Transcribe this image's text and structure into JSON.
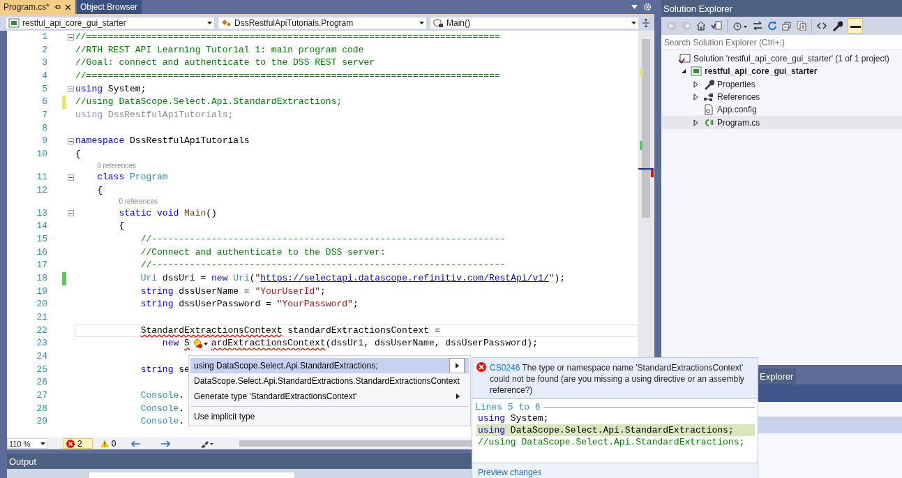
{
  "editor": {
    "tabs": [
      {
        "label": "Program.cs*",
        "selected": true
      },
      {
        "label": "Object Browser",
        "selected": false
      }
    ],
    "navigation": [
      {
        "kind": "project",
        "label": "restful_api_core_gui_starter"
      },
      {
        "kind": "class",
        "label": "DssRestfulApiTutorials.Program"
      },
      {
        "kind": "method",
        "label": "Main()"
      }
    ],
    "lines": [
      {
        "kind": "code",
        "number": "1",
        "fold": true,
        "current": false,
        "segs": [
          {
            "kind": "comment",
            "t": "//============================================================================"
          }
        ]
      },
      {
        "kind": "code",
        "number": "2",
        "fold": false,
        "current": false,
        "segs": [
          {
            "kind": "comment",
            "t": "//RTH REST API Learning Tutorial 1: main program code"
          }
        ]
      },
      {
        "kind": "code",
        "number": "3",
        "fold": false,
        "current": false,
        "segs": [
          {
            "kind": "comment",
            "t": "//Goal: connect and authenticate to the DSS REST server"
          }
        ]
      },
      {
        "kind": "code",
        "number": "4",
        "fold": false,
        "current": false,
        "segs": [
          {
            "kind": "comment",
            "t": "//============================================================================"
          }
        ]
      },
      {
        "kind": "code",
        "number": "5",
        "fold": true,
        "current": false,
        "segs": [
          {
            "kind": "keyword",
            "t": "using"
          },
          {
            "kind": "plain",
            "t": " System;"
          }
        ]
      },
      {
        "kind": "code",
        "number": "6",
        "fold": false,
        "current": false,
        "color": "#efe56b",
        "segs": [
          {
            "kind": "comment",
            "t": "//using DataScope.Select.Api.StandardExtractions;"
          }
        ]
      },
      {
        "kind": "code",
        "number": "7",
        "fold": false,
        "current": false,
        "segs": [
          {
            "kind": "dim_keyword",
            "t": "using"
          },
          {
            "kind": "dim",
            "t": " DssRestfulApiTutorials;"
          }
        ]
      },
      {
        "kind": "code",
        "number": "8",
        "fold": false,
        "current": false
      },
      {
        "kind": "code",
        "number": "9",
        "fold": true,
        "current": false,
        "segs": [
          {
            "kind": "keyword",
            "t": "namespace"
          },
          {
            "kind": "plain",
            "t": " DssRestfulApiTutorials"
          }
        ]
      },
      {
        "kind": "code",
        "number": "10",
        "fold": false,
        "current": false,
        "segs": [
          {
            "kind": "plain",
            "t": "{"
          }
        ]
      },
      {
        "kind": "codelens",
        "text": "0 references"
      },
      {
        "kind": "code",
        "number": "11",
        "fold": true,
        "current": false,
        "segs": [
          {
            "kind": "keyword",
            "t": "    class"
          },
          {
            "kind": "type",
            "t": " Program"
          }
        ]
      },
      {
        "kind": "code",
        "number": "12",
        "fold": false,
        "current": false,
        "segs": [
          {
            "kind": "plain",
            "t": "    {"
          }
        ]
      },
      {
        "kind": "codelens",
        "text": "0 references"
      },
      {
        "kind": "code",
        "number": "13",
        "fold": true,
        "current": false,
        "segs": [
          {
            "kind": "keyword",
            "t": "        static void"
          },
          {
            "kind": "method",
            "t": " Main"
          },
          {
            "kind": "plain",
            "t": "()"
          }
        ]
      },
      {
        "kind": "code",
        "number": "14",
        "fold": false,
        "current": false,
        "segs": [
          {
            "kind": "plain",
            "t": "        {"
          }
        ]
      },
      {
        "kind": "code",
        "number": "15",
        "fold": false,
        "current": false,
        "segs": [
          {
            "kind": "comment",
            "t": "            //-----------------------------------------------------------------"
          }
        ]
      },
      {
        "kind": "code",
        "number": "16",
        "fold": false,
        "current": false,
        "segs": [
          {
            "kind": "comment",
            "t": "            //Connect and authenticate to the DSS server:"
          }
        ]
      },
      {
        "kind": "code",
        "number": "17",
        "fold": false,
        "current": false,
        "segs": [
          {
            "kind": "comment",
            "t": "            //-----------------------------------------------------------------"
          }
        ]
      },
      {
        "kind": "code",
        "number": "18",
        "fold": false,
        "current": false,
        "color": "#57c960",
        "segs": [
          {
            "kind": "type",
            "t": "            Uri"
          },
          {
            "kind": "plain",
            "t": " dssUri = "
          },
          {
            "kind": "keyword",
            "t": "new"
          },
          {
            "kind": "type",
            "t": " Uri"
          },
          {
            "kind": "plain",
            "t": "("
          },
          {
            "kind": "string",
            "t": "\""
          },
          {
            "kind": "link",
            "t": "https://selectapi.datascope.refinitiv.com/RestApi/v1/"
          },
          {
            "kind": "string",
            "t": "\""
          },
          {
            "kind": "plain",
            "t": ");"
          }
        ]
      },
      {
        "kind": "code",
        "number": "19",
        "fold": false,
        "current": false,
        "segs": [
          {
            "kind": "keyword",
            "t": "            string"
          },
          {
            "kind": "plain",
            "t": " dssUserName = "
          },
          {
            "kind": "string",
            "t": "\"YourUserId\""
          },
          {
            "kind": "plain",
            "t": ";"
          }
        ]
      },
      {
        "kind": "code",
        "number": "20",
        "fold": false,
        "current": false,
        "segs": [
          {
            "kind": "keyword",
            "t": "            string"
          },
          {
            "kind": "plain",
            "t": " dssUserPassword = "
          },
          {
            "kind": "string",
            "t": "\"YourPassword\""
          },
          {
            "kind": "plain",
            "t": ";"
          }
        ]
      },
      {
        "kind": "code",
        "number": "21",
        "fold": false,
        "current": false
      },
      {
        "kind": "code",
        "number": "22",
        "fold": false,
        "current": true,
        "segs": [
          {
            "kind": "plain",
            "t": "            StandardExtractionsContext",
            "squiggle": true
          },
          {
            "kind": "plain",
            "t": " standardExtractionsContext ="
          }
        ]
      },
      {
        "kind": "code",
        "number": "23",
        "fold": false,
        "current": false,
        "segs": [
          {
            "kind": "keyword",
            "t": "                new "
          },
          {
            "kind": "plain",
            "t": "S",
            "squiggle": true
          },
          {
            "kind": "lightbulb"
          },
          {
            "kind": "plain",
            "t": "ardExtractionsContext",
            "squiggle": true
          },
          {
            "kind": "plain",
            "t": "(dssUri, dssUserName, dssUserPassword);"
          }
        ]
      },
      {
        "kind": "code",
        "number": "24",
        "fold": false,
        "current": false
      },
      {
        "kind": "code",
        "number": "25",
        "fold": false,
        "current": false,
        "segs": [
          {
            "kind": "keyword",
            "t": "            string"
          },
          {
            "kind": "plain",
            "t": " se"
          }
        ]
      },
      {
        "kind": "code",
        "number": "26",
        "fold": false,
        "current": false
      },
      {
        "kind": "code",
        "number": "27",
        "fold": false,
        "current": false,
        "segs": [
          {
            "kind": "type",
            "t": "            Console"
          },
          {
            "kind": "plain",
            "t": "."
          }
        ]
      },
      {
        "kind": "code",
        "number": "28",
        "fold": false,
        "current": false,
        "segs": [
          {
            "kind": "type",
            "t": "            Console"
          },
          {
            "kind": "plain",
            "t": "."
          }
        ]
      },
      {
        "kind": "code",
        "number": "29",
        "fold": false,
        "current": false,
        "segs": [
          {
            "kind": "type",
            "t": "            Console"
          },
          {
            "kind": "plain",
            "t": "."
          }
        ]
      }
    ],
    "status": {
      "zoom": "110 %",
      "errors": "2",
      "warnings": "0"
    }
  },
  "quick_actions": {
    "groups": [
      [
        {
          "label": "using DataScope.Select.Api.StandardExtractions;",
          "selected": true,
          "submenu": true
        },
        {
          "label": "DataScope.Select.Api.StandardExtractions.StandardExtractionsContext",
          "selected": false,
          "submenu": false
        },
        {
          "label": "Generate type 'StandardExtractionsContext'",
          "selected": false,
          "submenu": true
        }
      ],
      [
        {
          "label": "Use implicit type",
          "selected": false,
          "submenu": false
        }
      ]
    ]
  },
  "preview": {
    "code": "CS0246",
    "message": "The type or namespace name 'StandardExtractionsContext' could not be found (are you missing a using directive or an assembly reference?)",
    "range": "Lines 5 to 6",
    "lines": [
      {
        "kind": "context",
        "segs": [
          {
            "kind": "keyword",
            "t": "using"
          },
          {
            "kind": "plain",
            "t": " System;"
          }
        ]
      },
      {
        "kind": "added",
        "segs": [
          {
            "kind": "keyword",
            "t": "using"
          },
          {
            "kind": "plain",
            "t": " DataScope.Select.Api.StandardExtractions;"
          }
        ]
      },
      {
        "kind": "context",
        "segs": [
          {
            "kind": "comment",
            "t": "//using DataScope.Select.Api.StandardExtractions;"
          }
        ]
      }
    ],
    "action": "Preview changes"
  },
  "output": {
    "title": "Output"
  },
  "solution_explorer": {
    "title": "Solution Explorer",
    "search": {
      "placeholder": "Search Solution Explorer (Ctrl+;)"
    },
    "tree": [
      {
        "kind": "solution",
        "label": "Solution 'restful_api_core_gui_starter' (1 of 1 project)",
        "selected": false,
        "children": [
          {
            "kind": "project",
            "label": "restful_api_core_gui_starter",
            "expanded": true,
            "selected": false,
            "children": [
              {
                "kind": "properties",
                "label": "Properties",
                "expanded": false,
                "selected": false
              },
              {
                "kind": "references",
                "label": "References",
                "expanded": false,
                "selected": false
              },
              {
                "kind": "config",
                "label": "App.config",
                "selected": false
              },
              {
                "kind": "csharp",
                "label": "Program.cs",
                "expanded": false,
                "selected": true
              }
            ]
          }
        ]
      }
    ]
  },
  "bottom_panel": {
    "tab": "Explorer"
  }
}
